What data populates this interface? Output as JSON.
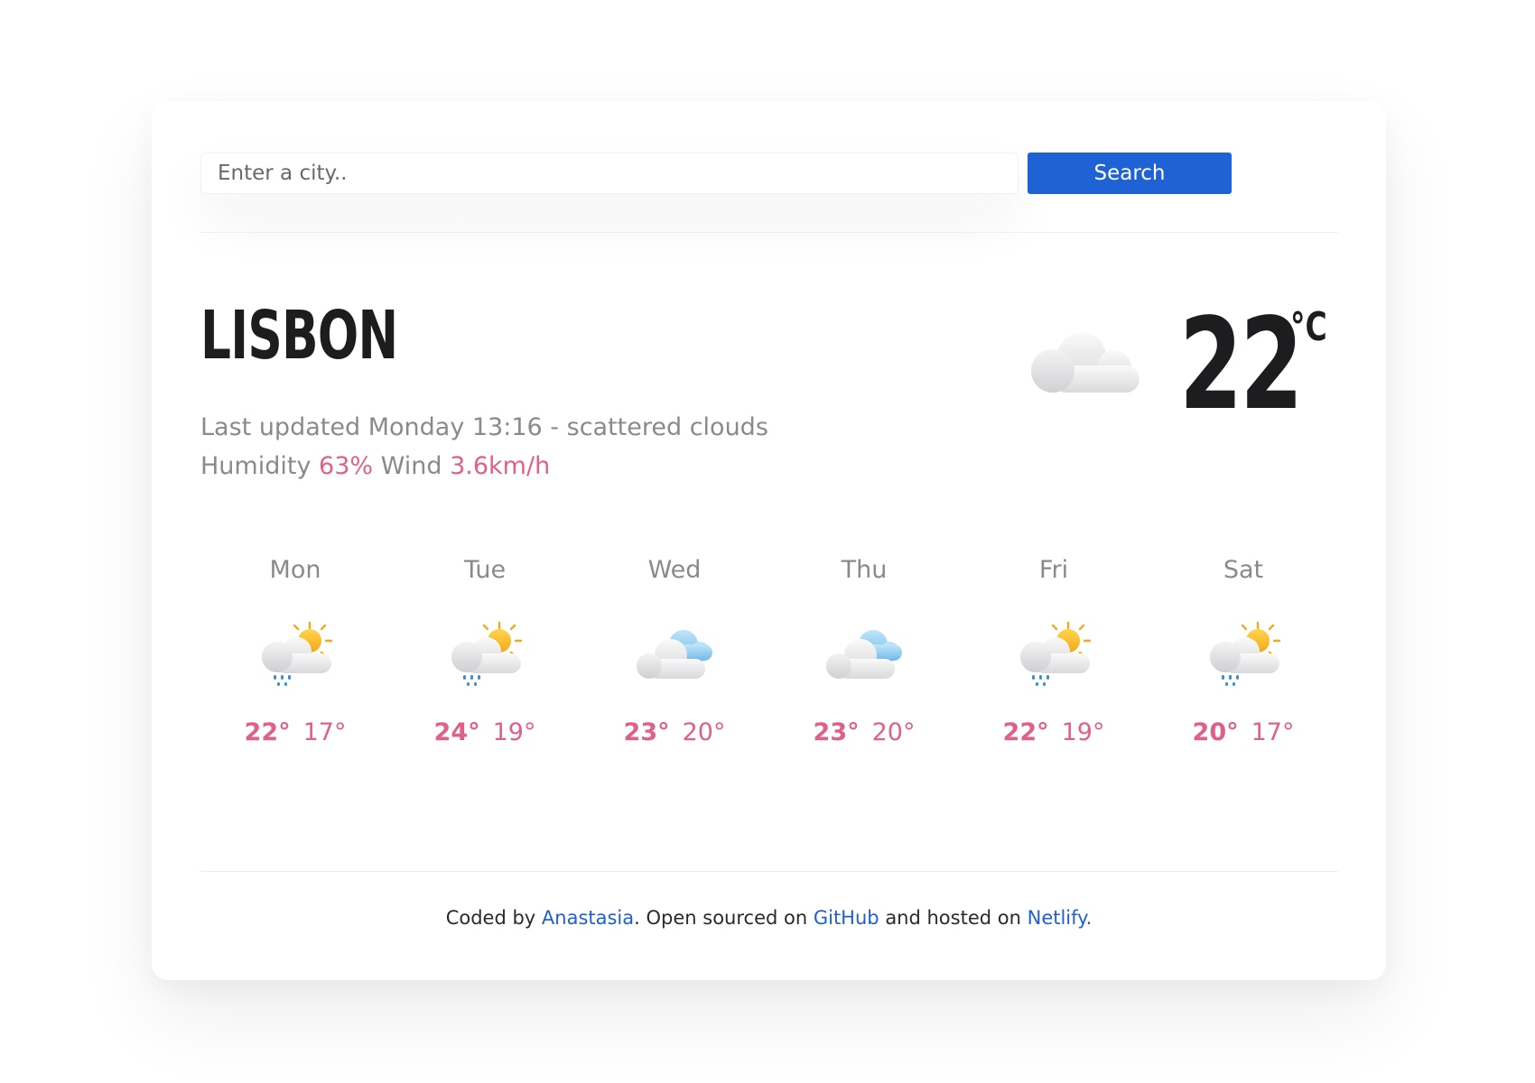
{
  "search": {
    "placeholder": "Enter a city..",
    "value": "",
    "button_label": "Search"
  },
  "current": {
    "city": "LISBON",
    "last_updated_prefix": "Last updated",
    "day_time": "Monday 13:16",
    "separator": "-",
    "description": "scattered clouds",
    "humidity_label": "Humidity",
    "humidity_value": "63%",
    "wind_label": "Wind",
    "wind_value": "3.6km/h",
    "temperature": "22",
    "unit": "°C",
    "icon": "cloud-icon"
  },
  "forecast": [
    {
      "day": "Mon",
      "max": "22°",
      "min": "17°",
      "icon": "rain-sun-icon"
    },
    {
      "day": "Tue",
      "max": "24°",
      "min": "19°",
      "icon": "rain-sun-icon"
    },
    {
      "day": "Wed",
      "max": "23°",
      "min": "20°",
      "icon": "cloudy-icon"
    },
    {
      "day": "Thu",
      "max": "23°",
      "min": "20°",
      "icon": "cloudy-icon"
    },
    {
      "day": "Fri",
      "max": "22°",
      "min": "19°",
      "icon": "rain-sun-icon"
    },
    {
      "day": "Sat",
      "max": "20°",
      "min": "17°",
      "icon": "rain-sun-icon"
    }
  ],
  "footer": {
    "text1": "Coded by",
    "author": "Anastasia",
    "text2": ". Open sourced on",
    "github": "GitHub",
    "text3": "and hosted on",
    "netlify": "Netlify",
    "text4": "."
  },
  "colors": {
    "accent": "#1f62d6",
    "highlight": "#e0608c",
    "muted": "#8a8a8e",
    "link": "#1f5fcf"
  }
}
